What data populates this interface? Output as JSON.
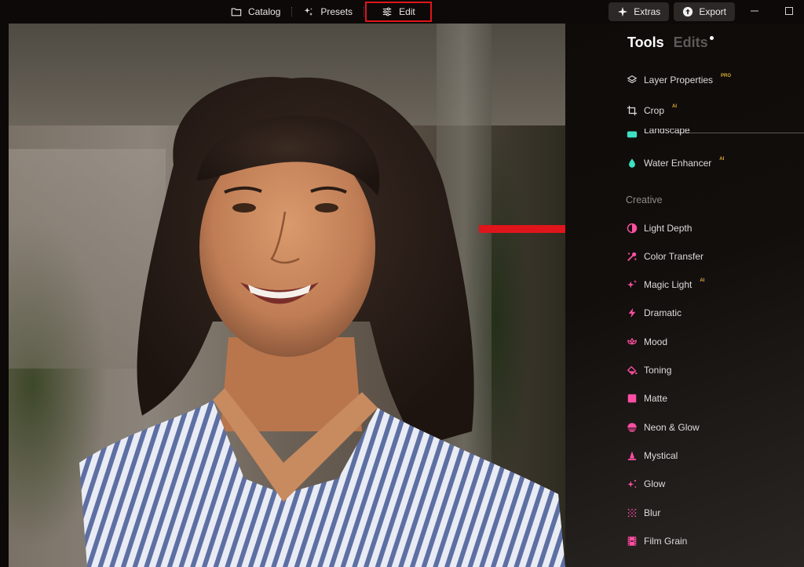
{
  "nav": {
    "catalog": "Catalog",
    "presets": "Presets",
    "edit": "Edit"
  },
  "actions": {
    "extras": "Extras",
    "export": "Export"
  },
  "panel": {
    "tab_tools": "Tools",
    "tab_edits": "Edits",
    "tools_top": [
      {
        "label": "Layer Properties",
        "badge": "PRO",
        "icon": "layers-icon"
      },
      {
        "label": "Crop",
        "badge": "AI",
        "icon": "crop-icon"
      },
      {
        "label": "Landscape",
        "badge": "",
        "icon": "landscape-icon"
      },
      {
        "label": "Water Enhancer",
        "badge": "AI",
        "icon": "water-drop-icon"
      }
    ],
    "section_creative": "Creative",
    "tools_creative": [
      {
        "label": "Light Depth",
        "badge": "",
        "icon": "light-depth-icon"
      },
      {
        "label": "Color Transfer",
        "badge": "",
        "icon": "color-transfer-icon"
      },
      {
        "label": "Magic Light",
        "badge": "AI",
        "icon": "sparkle-icon"
      },
      {
        "label": "Dramatic",
        "badge": "",
        "icon": "lightning-icon"
      },
      {
        "label": "Mood",
        "badge": "",
        "icon": "lotus-icon"
      },
      {
        "label": "Toning",
        "badge": "",
        "icon": "paint-bucket-icon"
      },
      {
        "label": "Matte",
        "badge": "",
        "icon": "square-icon"
      },
      {
        "label": "Neon & Glow",
        "badge": "",
        "icon": "sunset-icon"
      },
      {
        "label": "Mystical",
        "badge": "",
        "icon": "mystical-icon"
      },
      {
        "label": "Glow",
        "badge": "",
        "icon": "glow-icon"
      },
      {
        "label": "Blur",
        "badge": "",
        "icon": "blur-icon"
      },
      {
        "label": "Film Grain",
        "badge": "",
        "icon": "film-icon"
      }
    ]
  },
  "colors": {
    "accent_pink": "#ff4fa3",
    "annotation_red": "#e0151b",
    "water_teal": "#3ee0c4",
    "pro_gold": "#d7a93a"
  }
}
